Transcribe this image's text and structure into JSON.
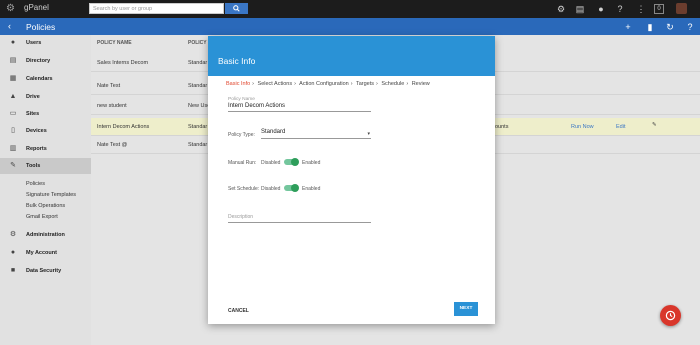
{
  "topbar": {
    "brand": "gPanel",
    "search_placeholder": "Search by user or group",
    "badge": "0"
  },
  "subbar": {
    "title": "Policies"
  },
  "sidebar": {
    "items": [
      {
        "label": "Users",
        "icon": "person-icon"
      },
      {
        "label": "Directory",
        "icon": "directory-icon"
      },
      {
        "label": "Calendars",
        "icon": "calendar-icon"
      },
      {
        "label": "Drive",
        "icon": "drive-icon"
      },
      {
        "label": "Sites",
        "icon": "sites-icon"
      },
      {
        "label": "Devices",
        "icon": "devices-icon"
      },
      {
        "label": "Reports",
        "icon": "reports-icon"
      },
      {
        "label": "Tools",
        "icon": "wrench-icon"
      }
    ],
    "tools_sub": [
      "Policies",
      "Signature Templates",
      "Bulk Operations",
      "Gmail Export"
    ],
    "items2": [
      {
        "label": "Administration",
        "icon": "gear-icon"
      },
      {
        "label": "My Account",
        "icon": "account-icon"
      },
      {
        "label": "Data Security",
        "icon": "lock-icon"
      }
    ]
  },
  "table": {
    "col1": "POLICY NAME",
    "col2": "POLICY T",
    "rows": [
      {
        "name": "Sales Interns Decom",
        "type": "Standar"
      },
      {
        "name": "Nate Test",
        "type": "Standar"
      },
      {
        "name": "new student",
        "type": "New Use"
      },
      {
        "name": "Intern Decom Actions",
        "type": "Standar",
        "extra": "ounts",
        "run": "Run Now",
        "edit": "Edit"
      },
      {
        "name": "Nate Test @",
        "type": "Standar"
      }
    ]
  },
  "modal": {
    "title": "Basic Info",
    "steps": [
      "Basic Info",
      "Select Actions",
      "Action Configuration",
      "Targets",
      "Schedule",
      "Review"
    ],
    "policy_name_label": "Policy Name",
    "policy_name_value": "Intern Decom Actions",
    "policy_type_label": "Policy Type:",
    "policy_type_value": "Standard",
    "manual_run_label": "Manual Run:",
    "set_schedule_label": "Set Schedule:",
    "disabled": "Disabled",
    "enabled": "Enabled",
    "description_placeholder": "Description",
    "cancel": "CANCEL",
    "next": "NEXT"
  }
}
